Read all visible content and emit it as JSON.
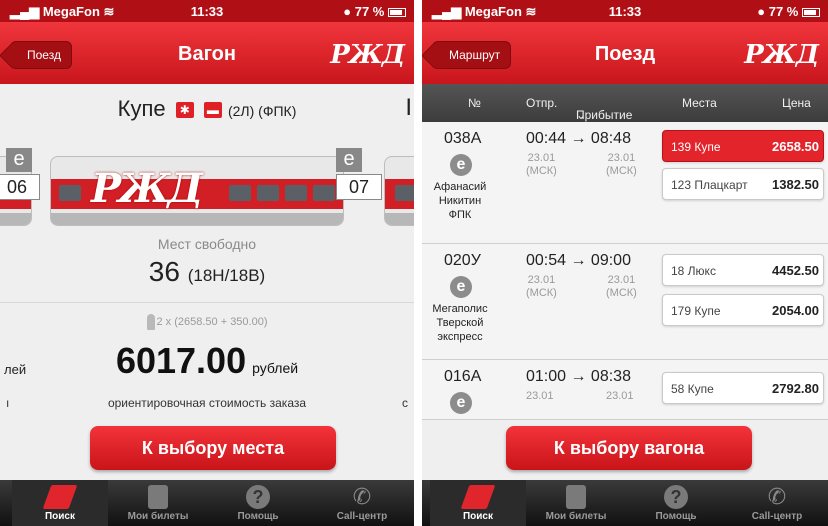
{
  "status": {
    "carrier": "MegaFon",
    "time": "11:33",
    "battery": "77 %"
  },
  "left": {
    "nav": {
      "back": "Поезд",
      "title": "Вагон",
      "logo": "РЖД"
    },
    "car_type": "Купе",
    "car_sub": "(2Л) (ФПК)",
    "wagon_prev_num": "06",
    "wagon_next_num": "07",
    "e_label": "e",
    "free_label": "Мест свободно",
    "free_count": "36",
    "free_detail": "(18Н/18В)",
    "formula": "2 x (2658.50 + 350.00)",
    "price": "6017.00",
    "currency": "рублей",
    "cut_left_text": "лей",
    "cost_note": "ориентировочная стоимость заказа",
    "cut_dot": "ı",
    "cut_dot_right": "c",
    "cut_title_right": "I",
    "button": "К выбору места"
  },
  "right": {
    "nav": {
      "back": "Маршрут",
      "title": "Поезд",
      "logo": "РЖД"
    },
    "columns": {
      "num": "№",
      "depart": "Отпр.",
      "arrive": "Прибытие",
      "seats": "Места",
      "price": "Цена"
    },
    "trains": [
      {
        "num": "038А",
        "icon": "e",
        "name": [
          "Афанасий",
          "Никитин",
          "ФПК"
        ],
        "time": "00:44 → 08:48",
        "dep_date": "23.01",
        "dep_tz": "(МСК)",
        "arr_date": "23.01",
        "arr_tz": "(МСК)",
        "seats": [
          {
            "cls": "139 Купе",
            "price": "2658.50",
            "selected": true
          },
          {
            "cls": "123 Плацкарт",
            "price": "1382.50",
            "selected": false
          }
        ]
      },
      {
        "num": "020У",
        "icon": "e",
        "name": [
          "Мегаполис",
          "Тверской",
          "экспресс"
        ],
        "time": "00:54 → 09:00",
        "dep_date": "23.01",
        "dep_tz": "(МСК)",
        "arr_date": "23.01",
        "arr_tz": "(МСК)",
        "seats": [
          {
            "cls": "18 Люкс",
            "price": "4452.50",
            "selected": false
          },
          {
            "cls": "179 Купе",
            "price": "2054.00",
            "selected": false
          }
        ]
      },
      {
        "num": "016А",
        "icon": "e",
        "name": [],
        "time": "01:00 → 08:38",
        "dep_date": "23.01",
        "dep_tz": "",
        "arr_date": "23.01",
        "arr_tz": "",
        "seats": [
          {
            "cls": "58 Купе",
            "price": "2792.80",
            "selected": false
          }
        ]
      }
    ],
    "button": "К выбору вагона"
  },
  "tabs": [
    "Поиск",
    "Мои билеты",
    "Помощь",
    "Call-центр"
  ],
  "icons": {
    "help": "?",
    "call": "✆"
  },
  "colors": {
    "accent": "#e0262c",
    "status_bar": "#b01015",
    "tab_bar": "#1a1a1a"
  }
}
